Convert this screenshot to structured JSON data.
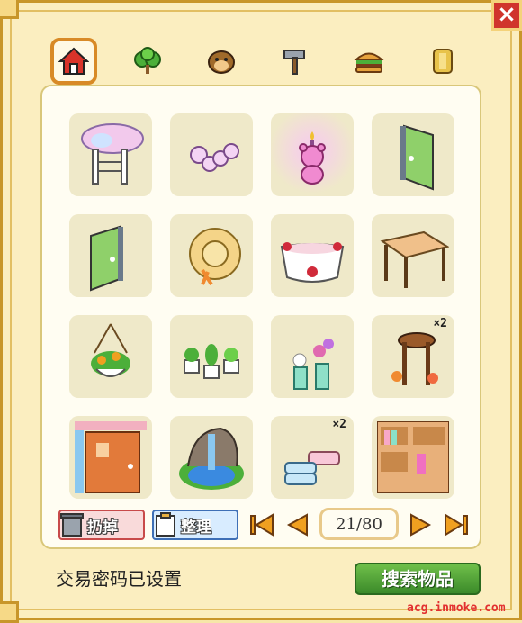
{
  "tabs": [
    {
      "id": "home",
      "icon": "house-icon",
      "active": true
    },
    {
      "id": "plant",
      "icon": "tree-icon",
      "active": false
    },
    {
      "id": "creature",
      "icon": "mole-icon",
      "active": false
    },
    {
      "id": "tools",
      "icon": "hammer-icon",
      "active": false
    },
    {
      "id": "food",
      "icon": "burger-icon",
      "active": false
    },
    {
      "id": "special",
      "icon": "cylinder-icon",
      "active": false
    }
  ],
  "items": [
    {
      "icon": "sakura-arch-icon",
      "qty": ""
    },
    {
      "icon": "pink-orbs-icon",
      "qty": ""
    },
    {
      "icon": "pink-bear-candle-icon",
      "qty": ""
    },
    {
      "icon": "green-door-right-icon",
      "qty": ""
    },
    {
      "icon": "green-door-left-icon",
      "qty": ""
    },
    {
      "icon": "straw-hat-icon",
      "qty": ""
    },
    {
      "icon": "ribbon-bathtub-icon",
      "qty": ""
    },
    {
      "icon": "wooden-table-icon",
      "qty": ""
    },
    {
      "icon": "hanging-flower-pot-icon",
      "qty": ""
    },
    {
      "icon": "cactus-pots-icon",
      "qty": ""
    },
    {
      "icon": "flower-vases-icon",
      "qty": ""
    },
    {
      "icon": "wooden-stool-icon",
      "qty": "×2"
    },
    {
      "icon": "orange-door-icon",
      "qty": ""
    },
    {
      "icon": "rock-fountain-icon",
      "qty": ""
    },
    {
      "icon": "towels-icon",
      "qty": "×2"
    },
    {
      "icon": "bookshelf-icon",
      "qty": ""
    }
  ],
  "controls": {
    "discard_label": "扔掉",
    "sort_label": "整理",
    "page_current": "21",
    "page_total": "80"
  },
  "status_text": "交易密码已设置",
  "search_label": "搜索物品",
  "watermark": "acg.inmoke.com",
  "close_label": "×"
}
